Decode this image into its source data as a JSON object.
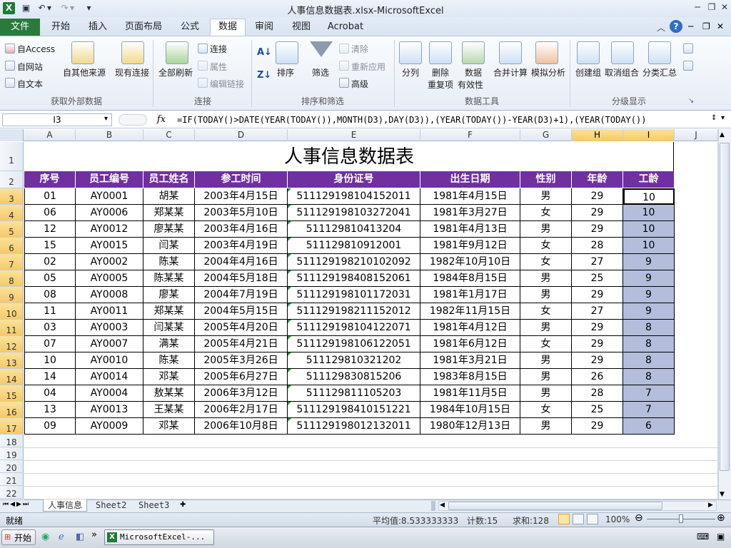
{
  "window": {
    "title": "人事信息数据表.xlsx - Microsoft Excel"
  },
  "tabs": [
    "文件",
    "开始",
    "插入",
    "页面布局",
    "公式",
    "数据",
    "审阅",
    "视图",
    "Acrobat"
  ],
  "ribbon": {
    "get_external": {
      "access": "自 Access",
      "web": "自网站",
      "text": "自文本",
      "other": "自其他来源",
      "existing": "现有连接",
      "group": "获取外部数据"
    },
    "connections": {
      "refresh": "全部刷新",
      "connections": "连接",
      "properties": "属性",
      "edit_links": "编辑链接",
      "group": "连接"
    },
    "sort_filter": {
      "sort": "排序",
      "filter": "筛选",
      "clear": "清除",
      "reapply": "重新应用",
      "advanced": "高级",
      "group": "排序和筛选"
    },
    "data_tools": {
      "split": "分列",
      "remove_dup1": "删除",
      "remove_dup2": "重复项",
      "validation1": "数据",
      "validation2": "有效性",
      "consolidate": "合并计算",
      "whatif": "模拟分析",
      "group": "数据工具"
    },
    "outline": {
      "group_btn": "创建组",
      "ungroup": "取消组合",
      "subtotal": "分类汇总",
      "group": "分级显示"
    }
  },
  "formula_bar": {
    "name_box": "I3",
    "fx": "fx",
    "formula": "=IF(TODAY()>DATE(YEAR(TODAY()),MONTH(D3),DAY(D3)),(YEAR(TODAY())-YEAR(D3)+1),(YEAR(TODAY())"
  },
  "columns": [
    "A",
    "B",
    "C",
    "D",
    "E",
    "F",
    "G",
    "H",
    "I",
    "J"
  ],
  "rows": [
    "1",
    "2",
    "3",
    "4",
    "5",
    "6",
    "7",
    "8",
    "9",
    "10",
    "11",
    "12",
    "13",
    "14",
    "15",
    "16",
    "17",
    "18",
    "19",
    "20",
    "21",
    "22"
  ],
  "sheet": {
    "title": "人事信息数据表",
    "headers": [
      "序号",
      "员工编号",
      "员工姓名",
      "参工时间",
      "身份证号",
      "出生日期",
      "性别",
      "年龄",
      "工龄"
    ],
    "data": [
      [
        "01",
        "AY0001",
        "胡某",
        "2003年4月15日",
        "511129198104152011",
        "1981年4月15日",
        "男",
        "29",
        "10"
      ],
      [
        "06",
        "AY0006",
        "郑某某",
        "2003年5月10日",
        "511129198103272041",
        "1981年3月27日",
        "女",
        "29",
        "10"
      ],
      [
        "12",
        "AY0012",
        "廖某某",
        "2003年4月16日",
        "51112981041320 4",
        "1981年4月13日",
        "男",
        "29",
        "10"
      ],
      [
        "15",
        "AY0015",
        "闫某",
        "2003年4月19日",
        "51112981091200 1",
        "1981年9月12日",
        "女",
        "28",
        "10"
      ],
      [
        "02",
        "AY0002",
        "陈某",
        "2004年4月16日",
        "511129198210102092",
        "1982年10月10日",
        "女",
        "27",
        "9"
      ],
      [
        "05",
        "AY0005",
        "陈某某",
        "2004年5月18日",
        "511129198408152061",
        "1984年8月15日",
        "男",
        "25",
        "9"
      ],
      [
        "08",
        "AY0008",
        "廖某",
        "2004年7月19日",
        "511129198101172031",
        "1981年1月17日",
        "男",
        "29",
        "9"
      ],
      [
        "11",
        "AY0011",
        "郑某某",
        "2004年5月15日",
        "511129198211152012",
        "1982年11月15日",
        "女",
        "27",
        "9"
      ],
      [
        "03",
        "AY0003",
        "闫某某",
        "2005年4月20日",
        "511129198104122071",
        "1981年4月12日",
        "男",
        "29",
        "8"
      ],
      [
        "07",
        "AY0007",
        "满某",
        "2005年4月21日",
        "511129198106122051",
        "1981年6月12日",
        "女",
        "29",
        "8"
      ],
      [
        "10",
        "AY0010",
        "陈某",
        "2005年3月26日",
        "51112981032120 2",
        "1981年3月21日",
        "男",
        "29",
        "8"
      ],
      [
        "14",
        "AY0014",
        "邓某",
        "2005年6月27日",
        "51112983081520 6",
        "1983年8月15日",
        "男",
        "26",
        "8"
      ],
      [
        "04",
        "AY0004",
        "敖某某",
        "2006年3月12日",
        "51112981110520 3",
        "1981年11月5日",
        "男",
        "28",
        "7"
      ],
      [
        "13",
        "AY0013",
        "王某某",
        "2006年2月17日",
        "511129198410151221",
        "1984年10月15日",
        "女",
        "25",
        "7"
      ],
      [
        "09",
        "AY0009",
        "邓某",
        "2006年10月8日",
        "511129198012132011",
        "1980年12月13日",
        "男",
        "29",
        "6"
      ]
    ]
  },
  "sheet_tabs": [
    "人事信息",
    "Sheet2",
    "Sheet3"
  ],
  "status": {
    "ready": "就绪",
    "average": "平均值: 8.533333333",
    "count": "计数: 15",
    "sum": "求和: 128",
    "zoom": "100%"
  },
  "taskbar": {
    "start": "开始",
    "app": "Microsoft Excel - ..."
  },
  "colors": {
    "header_bg": "#7030a0",
    "selection": "#b4bedc",
    "file_tab": "#2a7a3b"
  }
}
